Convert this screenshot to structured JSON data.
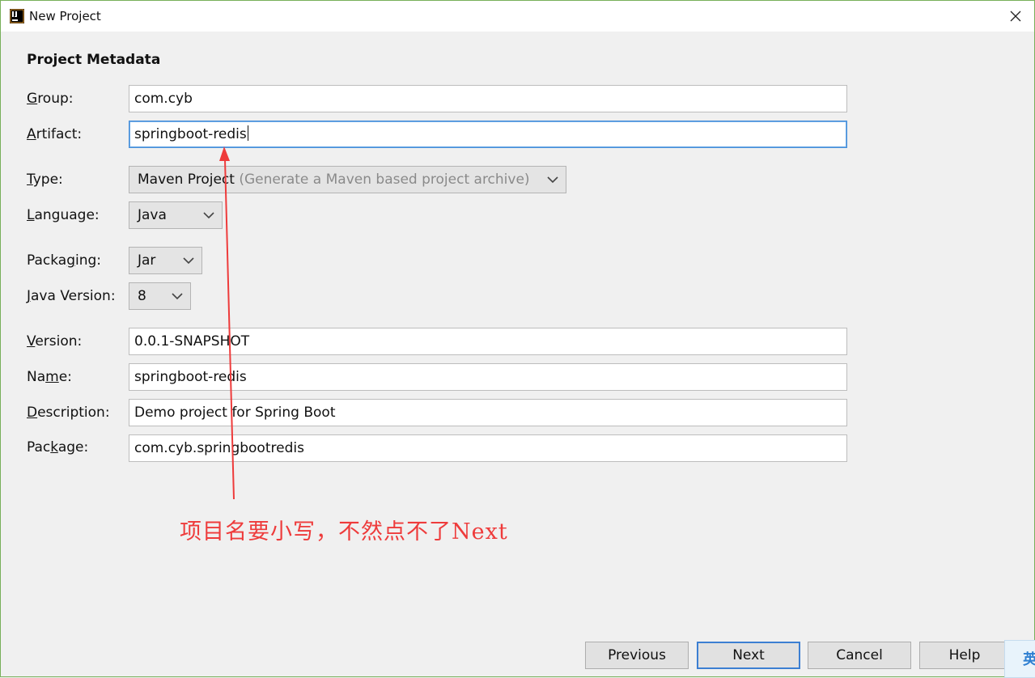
{
  "window": {
    "title": "New Project"
  },
  "section_title": "Project Metadata",
  "fields": {
    "group": {
      "label_mn": "G",
      "label_rest": "roup:",
      "value": "com.cyb"
    },
    "artifact": {
      "label_mn": "A",
      "label_rest": "rtifact:",
      "value": "springboot-redis"
    },
    "type": {
      "label_mn": "T",
      "label_rest": "ype:",
      "value": "Maven Project",
      "hint": "(Generate a Maven based project archive)"
    },
    "language": {
      "label_pre": "",
      "label_mn": "L",
      "label_rest": "anguage:",
      "value": "Java"
    },
    "packaging": {
      "label_pre": "Packa",
      "label_mn": "g",
      "label_rest": "ing:",
      "value": "Jar"
    },
    "java_version": {
      "label_mn": "J",
      "label_rest": "ava Version:",
      "value": "8"
    },
    "version": {
      "label_mn": "V",
      "label_rest": "ersion:",
      "value": "0.0.1-SNAPSHOT"
    },
    "name": {
      "label_pre": "Na",
      "label_mn": "m",
      "label_rest": "e:",
      "value": "springboot-redis"
    },
    "description": {
      "label_mn": "D",
      "label_rest": "escription:",
      "value": "Demo project for Spring Boot"
    },
    "package": {
      "label_pre": "Pac",
      "label_mn": "k",
      "label_rest": "age:",
      "value": "com.cyb.springbootredis"
    }
  },
  "annotation": {
    "text": "项目名要小写，不然点不了Next",
    "color": "#ee3b3b"
  },
  "buttons": {
    "previous": "Previous",
    "next": "Next",
    "cancel": "Cancel",
    "help": "Help"
  },
  "ime_indicator": "英",
  "colors": {
    "focus_border": "#4a90d9",
    "default_button_border": "#3c7fd2",
    "window_border": "#78b05a"
  }
}
